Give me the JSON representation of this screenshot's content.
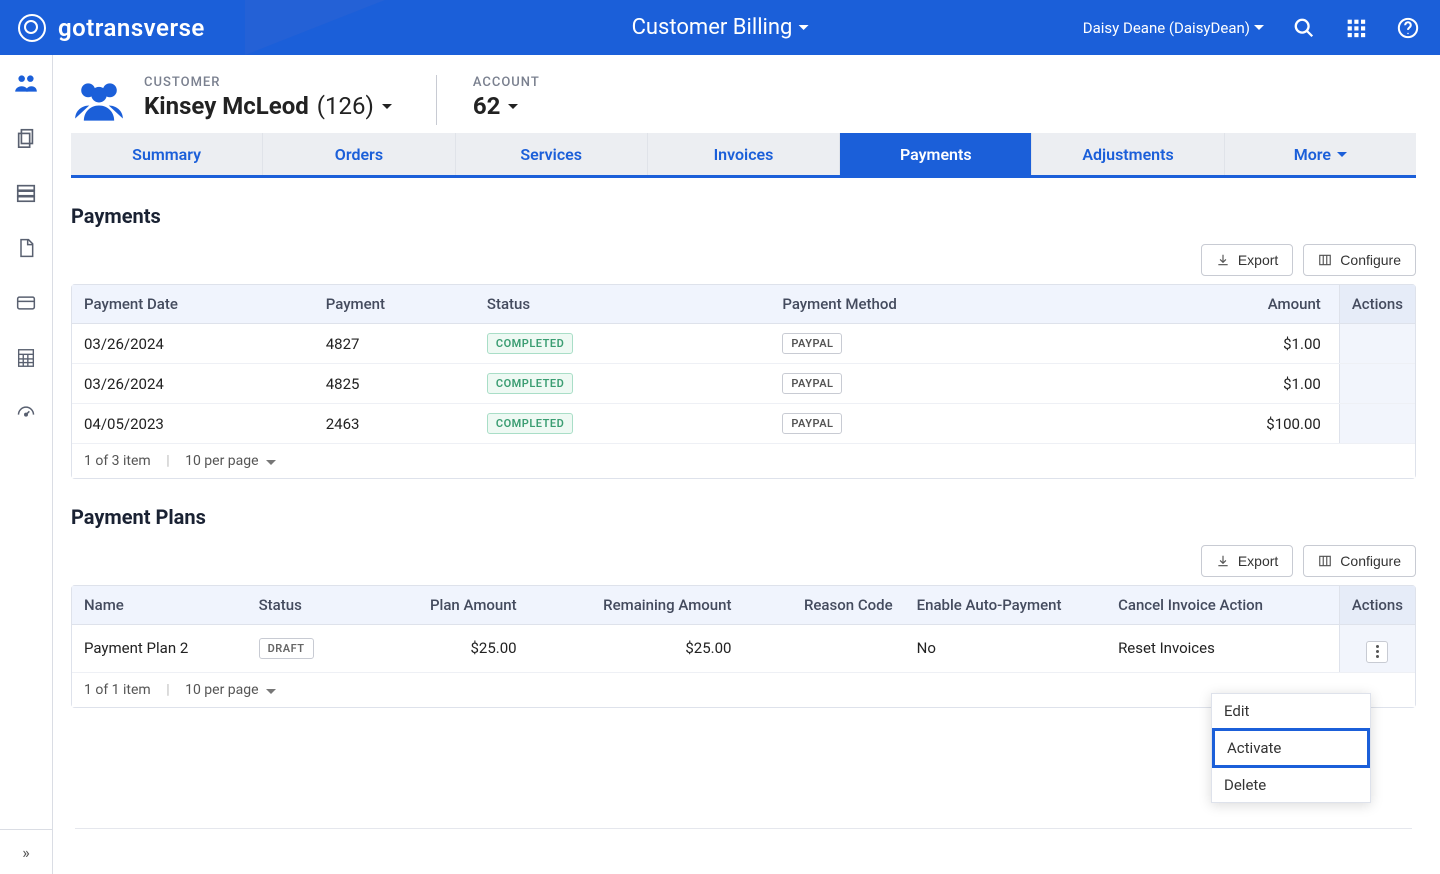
{
  "header": {
    "brand": "gotransverse",
    "title": "Customer Billing",
    "user_display": "Daisy Deane (DaisyDean)"
  },
  "breadcrumb": {
    "customer_label": "CUSTOMER",
    "customer_name": "Kinsey McLeod",
    "customer_number": "(126)",
    "account_label": "ACCOUNT",
    "account_number": "62"
  },
  "tabs": {
    "items": [
      "Summary",
      "Orders",
      "Services",
      "Invoices",
      "Payments",
      "Adjustments"
    ],
    "more_label": "More",
    "active": "Payments"
  },
  "payments_section": {
    "title": "Payments",
    "export_label": "Export",
    "configure_label": "Configure",
    "columns": {
      "date": "Payment Date",
      "payment": "Payment",
      "status": "Status",
      "method": "Payment Method",
      "amount": "Amount",
      "actions": "Actions"
    },
    "rows": [
      {
        "date": "03/26/2024",
        "payment": "4827",
        "status": "COMPLETED",
        "method": "PAYPAL",
        "amount": "$1.00"
      },
      {
        "date": "03/26/2024",
        "payment": "4825",
        "status": "COMPLETED",
        "method": "PAYPAL",
        "amount": "$1.00"
      },
      {
        "date": "04/05/2023",
        "payment": "2463",
        "status": "COMPLETED",
        "method": "PAYPAL",
        "amount": "$100.00"
      }
    ],
    "footer_count": "1 of 3 item",
    "footer_perpage": "10 per page"
  },
  "plans_section": {
    "title": "Payment Plans",
    "export_label": "Export",
    "configure_label": "Configure",
    "columns": {
      "name": "Name",
      "status": "Status",
      "plan_amount": "Plan Amount",
      "remaining": "Remaining Amount",
      "reason": "Reason Code",
      "autopay": "Enable Auto-Payment",
      "cancel_action": "Cancel Invoice Action",
      "actions": "Actions"
    },
    "rows": [
      {
        "name": "Payment Plan 2",
        "status": "DRAFT",
        "plan_amount": "$25.00",
        "remaining": "$25.00",
        "reason": "",
        "autopay": "No",
        "cancel_action": "Reset Invoices"
      }
    ],
    "footer_count": "1 of 1 item",
    "footer_perpage": "10 per page"
  },
  "dropdown": {
    "edit": "Edit",
    "activate": "Activate",
    "delete": "Delete"
  }
}
